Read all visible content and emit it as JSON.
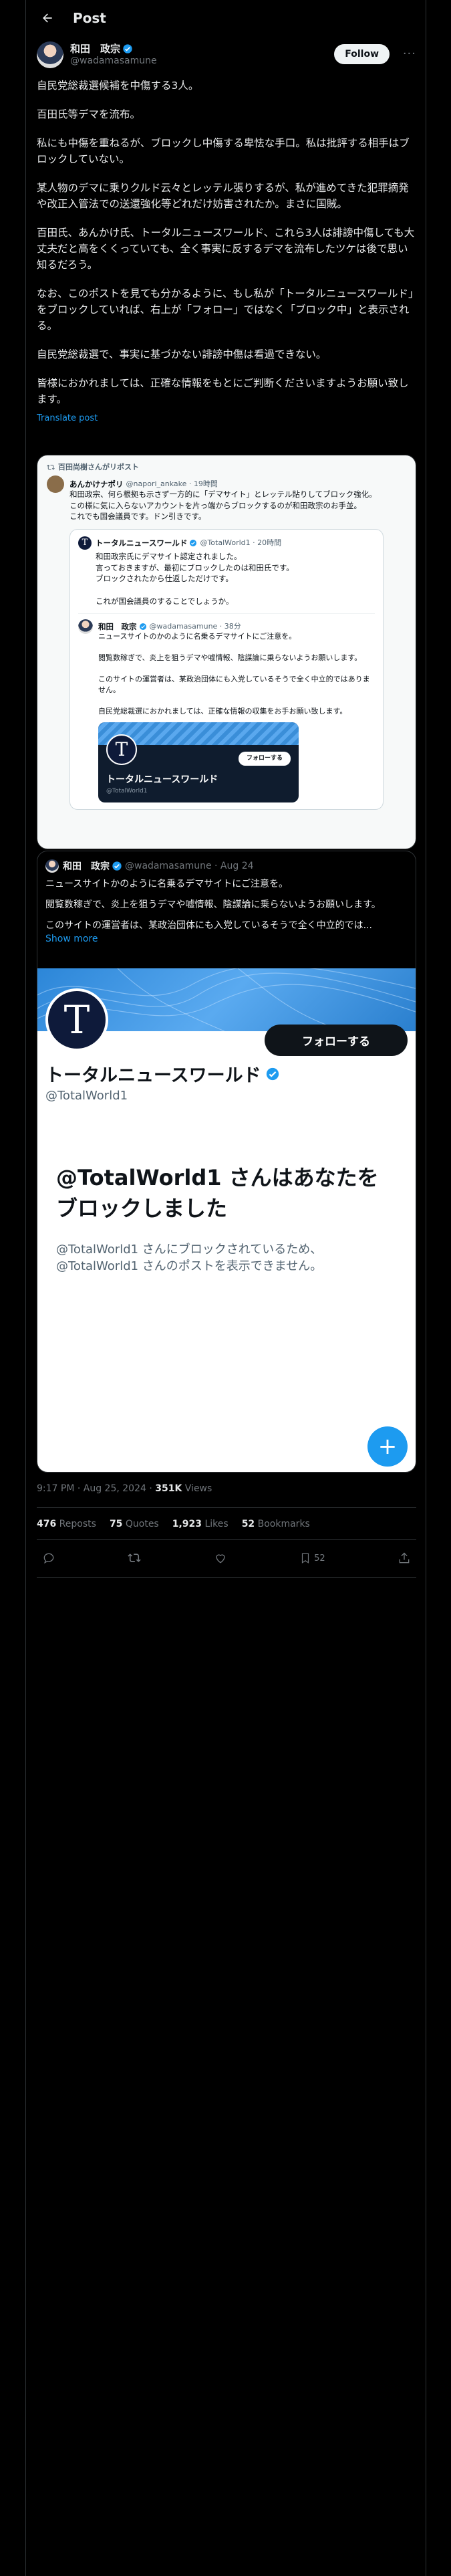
{
  "header": {
    "title": "Post"
  },
  "post": {
    "author_name": "和田　政宗",
    "handle": "@wadamasamune",
    "follow_label": "Follow",
    "paragraphs": [
      "自民党総裁選候補を中傷する3人。",
      "百田氏等デマを流布。",
      "私にも中傷を重ねるが、ブロックし中傷する卑怯な手口。私は批評する相手はブロックしていない。",
      "某人物のデマに乗りクルド云々とレッテル張りするが、私が進めてきた犯罪摘発や改正入管法での送還強化等どれだけ妨害されたか。まさに国賊。",
      "百田氏、あんかけ氏、トータルニュースワールド、これら3人は誹謗中傷しても大丈夫だと高をくくっていても、全く事実に反するデマを流布したツケは後で思い知るだろう。",
      "なお、このポストを見ても分かるように、もし私が「トータルニュースワールド」をブロックしていれば、右上が「フォロー」ではなく「ブロック中」と表示される。",
      "自民党総裁選で、事実に基づかない誹謗中傷は看過できない。",
      "皆様におかれましては、正確な情報をもとにご判断くださいますようお願い致します。"
    ],
    "translate": "Translate post"
  },
  "quote1": {
    "repost_by": "百田尚樹さんがリポスト",
    "author": "あんかけナポリ",
    "handle": "@napori_ankake · 19時間",
    "text": "和田政宗、何ら根拠も示さず一方的に「デマサイト」とレッテル貼りしてブロック強化。\nこの様に気に入らないアカウントを片っ端からブロックするのが和田政宗のお手並。\nこれでも国会議員です。ドン引きです。",
    "inner_author": "トータルニュースワールド",
    "inner_handle": "@TotalWorld1 · 20時間",
    "inner_text": "和田政宗氏にデマサイト認定されました。\n言っておきますが、最初にブロックしたのは和田氏です。\nブロックされたから仕返しただけです。\n\nこれが国会議員のすることでしょうか。",
    "deep_author": "和田　政宗",
    "deep_handle": "@wadamasamune · 38分",
    "deep_text": "ニュースサイトのかのように名乗るデマサイトにご注意を。\n\n閲覧数稼ぎで、炎上を狙うデマや嘘情報、陰謀論に乗らないようお願いします。\n\nこのサイトの運営者は、某政治団体にも入党しているそうで全く中立的ではありません。\n\n自民党総裁選におかれましては、正確な情報の収集をお手お願い致します。",
    "card_follow": "フォローする",
    "card_name": "トータルニュースワールド",
    "card_handle": "@TotalWorld1"
  },
  "quote2": {
    "author": "和田　政宗",
    "handle": "@wadamasamune · Aug 24",
    "paragraphs": [
      "ニュースサイトかのように名乗るデマサイトにご注意を。",
      "閲覧数稼ぎで、炎上を狙うデマや嘘情報、陰謀論に乗らないようお願いします。",
      "このサイトの運営者は、某政治団体にも入党しているそうで全く中立的では..."
    ],
    "show_more": "Show more",
    "img_follow": "フォローする",
    "img_name": "トータルニュースワールド",
    "img_handle": "@TotalWorld1",
    "blocked_title": "@TotalWorld1 さんはあなたをブロックしました",
    "blocked_sub": "@TotalWorld1 さんにブロックされているため、@TotalWorld1 さんのポストを表示できません。"
  },
  "meta": {
    "time": "9:17 PM · Aug 25, 2024 · ",
    "views_count": "351K",
    "views_label": " Views"
  },
  "stats": {
    "reposts": "476",
    "reposts_label": " Reposts",
    "quotes": "75",
    "quotes_label": " Quotes",
    "likes": "1,923",
    "likes_label": " Likes",
    "bookmarks": "52",
    "bookmarks_label": " Bookmarks"
  },
  "actions": {
    "bookmark_count": "52"
  }
}
